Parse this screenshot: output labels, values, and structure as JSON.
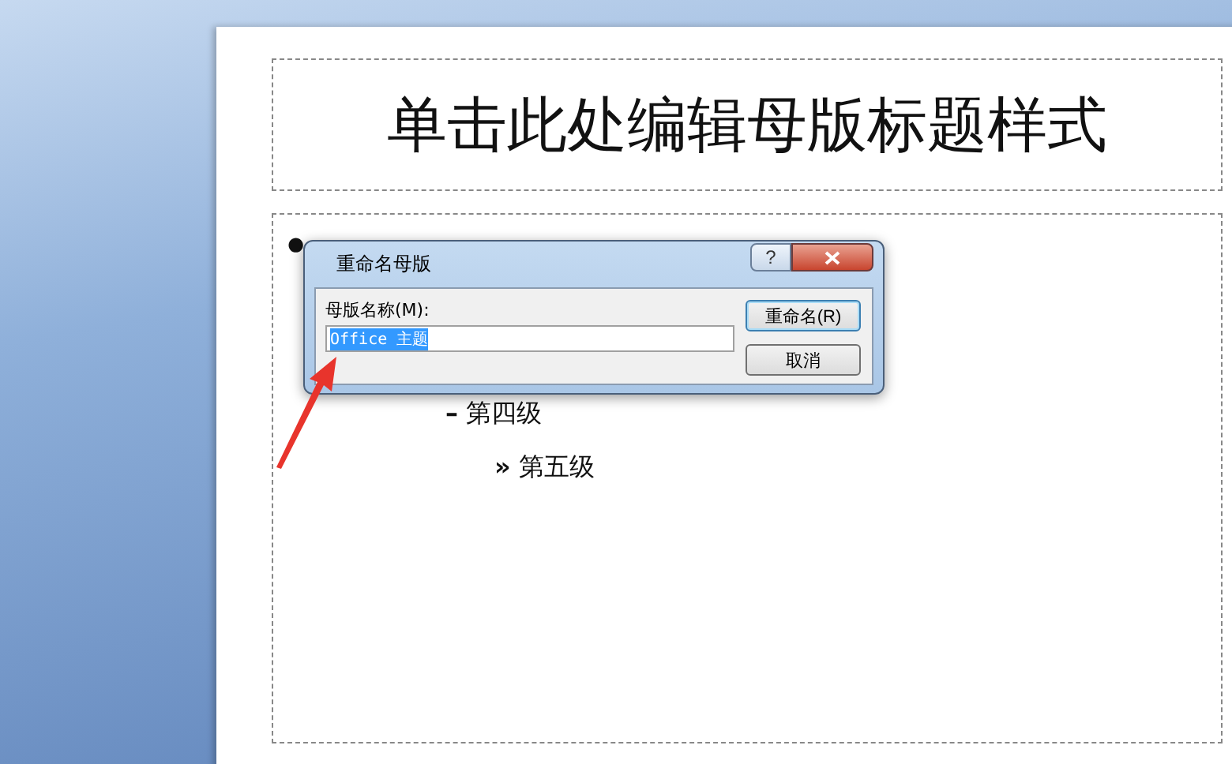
{
  "slide": {
    "title": "单击此处编辑母版标题样式",
    "body": [
      {
        "marker": "•",
        "children": [
          {
            "marker": "–",
            "text": "第四级",
            "children": [
              {
                "marker": "»",
                "text": "第五级"
              }
            ]
          }
        ]
      }
    ]
  },
  "dialog": {
    "title": "重命名母版",
    "help": "?",
    "field": {
      "label": "母版名称(M):",
      "value": "Office 主题",
      "selected": true
    },
    "buttons": [
      {
        "label": "重命名(R)",
        "default": true
      },
      {
        "label": "取消",
        "default": false
      }
    ]
  }
}
